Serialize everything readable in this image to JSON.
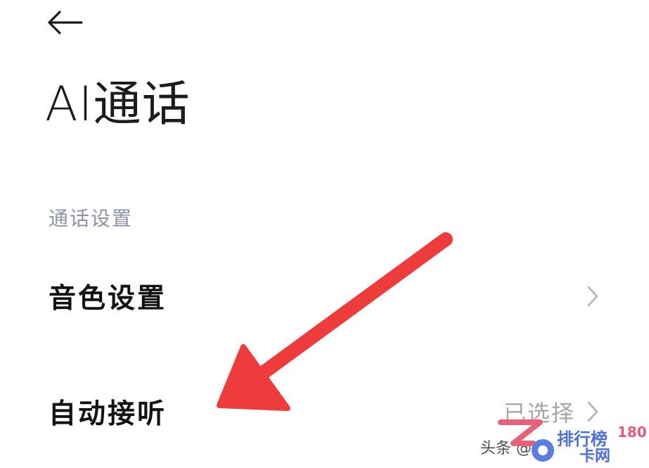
{
  "header": {
    "back_icon": "arrow-left-icon"
  },
  "page": {
    "title": "AI通话"
  },
  "section": {
    "header": "通话设置"
  },
  "rows": [
    {
      "label": "音色设置",
      "value": "",
      "icon": "chevron-right-icon"
    },
    {
      "label": "自动接听",
      "value": "已选择",
      "icon": "chevron-right-icon"
    }
  ],
  "watermark": {
    "text": "头条 @小",
    "logo_line1": "排行榜",
    "logo_number": "180",
    "logo_line2": "卡网"
  },
  "colors": {
    "annotation_arrow": "#ee3b3b",
    "section_header": "#8c93a8",
    "secondary_text": "#a6a6a6"
  }
}
